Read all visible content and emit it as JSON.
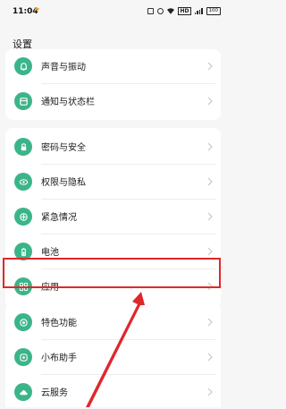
{
  "status_bar": {
    "time": "11:04",
    "network": "HD",
    "battery": "100"
  },
  "page_title": "设置",
  "items": [
    {
      "label": "声音与振动",
      "icon": "bell-icon"
    },
    {
      "label": "通知与状态栏",
      "icon": "notification-icon"
    },
    {
      "label": "密码与安全",
      "icon": "lock-icon"
    },
    {
      "label": "权限与隐私",
      "icon": "privacy-icon"
    },
    {
      "label": "紧急情况",
      "icon": "emergency-icon"
    },
    {
      "label": "电池",
      "icon": "battery-icon"
    },
    {
      "label": "应用",
      "icon": "apps-icon"
    },
    {
      "label": "特色功能",
      "icon": "special-features-icon"
    },
    {
      "label": "小布助手",
      "icon": "assistant-icon"
    },
    {
      "label": "云服务",
      "icon": "cloud-icon"
    }
  ],
  "colors": {
    "icon_green": "#3cb48a",
    "highlight_red": "#e0272b"
  }
}
